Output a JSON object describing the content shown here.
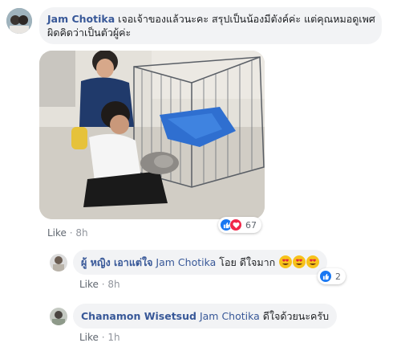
{
  "comments": [
    {
      "author": "Jam Chotika",
      "text_line1": "เจอเจ้าของแล้วนะคะ สรุปเป็นน้องมีตังค์ค่ะ แต่คุณหมอดูเพศ",
      "text_line2": "ผิดคิดว่าเป็นตัวผู้ค่ะ",
      "like_label": "Like",
      "sep": "·",
      "time": "8h",
      "reaction_count": "67"
    },
    {
      "author": "ผู้ หญิง เอาแต่ใจ",
      "mention": "Jam Chotika",
      "text": "โอย ดีใจมาก",
      "like_label": "Like",
      "sep": "·",
      "time": "8h",
      "reaction_count": "2"
    },
    {
      "author": "Chanamon Wisetsud",
      "mention": "Jam Chotika",
      "text": "ดีใจด้วยนะครับ",
      "like_label": "Like",
      "sep": "·",
      "time": "1h"
    }
  ],
  "colors": {
    "link": "#385898",
    "bubble": "#f2f3f5",
    "like_blue": "#1877f2",
    "heart_red": "#f0284a",
    "emoji_yellow": "#f7c21b"
  },
  "icons": [
    "thumbs-up-icon",
    "heart-react-icon",
    "heart-eyes-emoji-icon"
  ]
}
